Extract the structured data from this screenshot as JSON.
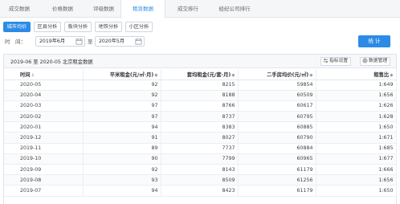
{
  "topnav": {
    "tabs": [
      {
        "label": "成交数据",
        "active": false
      },
      {
        "label": "价格数据",
        "active": false
      },
      {
        "label": "评级数据",
        "active": false
      },
      {
        "label": "租赁数据",
        "active": true
      },
      {
        "label": "成交排行",
        "active": false
      },
      {
        "label": "经纪公司排行",
        "active": false
      }
    ]
  },
  "subtabs": [
    {
      "label": "城市均价",
      "active": true
    },
    {
      "label": "区县分析",
      "active": false
    },
    {
      "label": "板块分析",
      "active": false
    },
    {
      "label": "地铁分析",
      "active": false
    },
    {
      "label": "小区分析",
      "active": false
    }
  ],
  "filter": {
    "time_label": "时　间：",
    "start": "2019年6月",
    "to_label": "至",
    "end": "2020年5月",
    "stat_button": "统 计"
  },
  "panel": {
    "title": "2019-06 至 2020-05 北京租金数据",
    "btn_indicator": "指标设置",
    "btn_data": "数据管理"
  },
  "table": {
    "headers": [
      "时间",
      "平米租金(元/㎡·月)",
      "套均租金(元/套·月)",
      "二手房均价(元/㎡)",
      "租售比"
    ],
    "sort_marks": [
      "↓",
      "◆",
      "◆",
      "◆",
      "◆"
    ],
    "rows": [
      [
        "2020-05",
        "92",
        "8215",
        "59854",
        "1:649"
      ],
      [
        "2020-04",
        "92",
        "8188",
        "60509",
        "1:656"
      ],
      [
        "2020-03",
        "97",
        "8766",
        "60617",
        "1:626"
      ],
      [
        "2020-02",
        "97",
        "8737",
        "60795",
        "1:628"
      ],
      [
        "2020-01",
        "94",
        "8383",
        "60885",
        "1:650"
      ],
      [
        "2019-12",
        "91",
        "8027",
        "60790",
        "1:671"
      ],
      [
        "2019-11",
        "89",
        "7737",
        "60884",
        "1:685"
      ],
      [
        "2019-10",
        "90",
        "7799",
        "60965",
        "1:677"
      ],
      [
        "2019-09",
        "92",
        "8143",
        "61179",
        "1:666"
      ],
      [
        "2019-08",
        "93",
        "8509",
        "61256",
        "1:656"
      ],
      [
        "2019-07",
        "94",
        "8423",
        "61179",
        "1:650"
      ]
    ]
  },
  "colors": {
    "accent": "#2b8be6"
  }
}
